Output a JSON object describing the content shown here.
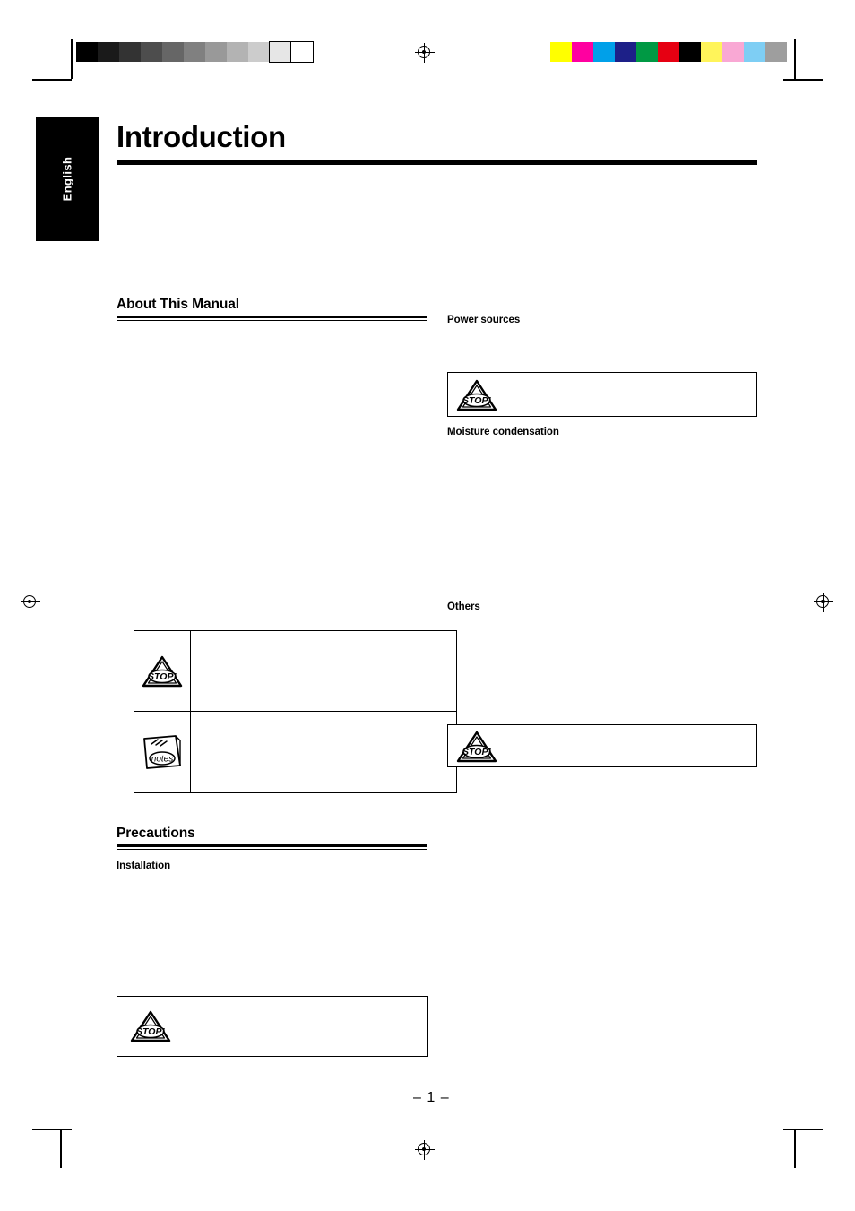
{
  "page": {
    "title": "Introduction",
    "side_tab_label": "English",
    "page_number": "– 1 –"
  },
  "sections": [
    {
      "id": "about-this-manual",
      "heading": "About This Manual"
    },
    {
      "id": "precautions",
      "heading": "Precautions"
    }
  ],
  "subheads": {
    "installation": "Installation",
    "power_sources": "Power sources",
    "moisture_condensation": "Moisture condensation",
    "others": "Others"
  },
  "legend_table": {
    "rows": [
      {
        "icon": "stop-icon",
        "text": ""
      },
      {
        "icon": "notes-icon",
        "text": ""
      }
    ]
  },
  "caution_boxes": [
    {
      "id": "caution-installation",
      "icon": "stop-icon",
      "text": ""
    },
    {
      "id": "caution-power-sources",
      "icon": "stop-icon",
      "text": ""
    },
    {
      "id": "caution-others",
      "icon": "stop-icon",
      "text": ""
    }
  ],
  "print_marks": {
    "grayscale_swatches": [
      "#000000",
      "#1a1a1a",
      "#333333",
      "#4d4d4d",
      "#666666",
      "#808080",
      "#999999",
      "#b3b3b3",
      "#cccccc",
      "#e6e6e6",
      "#ffffff"
    ],
    "color_swatches": [
      "#ffff00",
      "#ff00a0",
      "#00a0e9",
      "#1d2088",
      "#009944",
      "#e60012",
      "#000000",
      "#fff45a",
      "#f9a8d4",
      "#7ecef4",
      "#9e9e9e"
    ],
    "registration_icon": "registration-target-icon"
  },
  "icons": {
    "stop_label": "STOP!",
    "notes_label": "notes"
  }
}
